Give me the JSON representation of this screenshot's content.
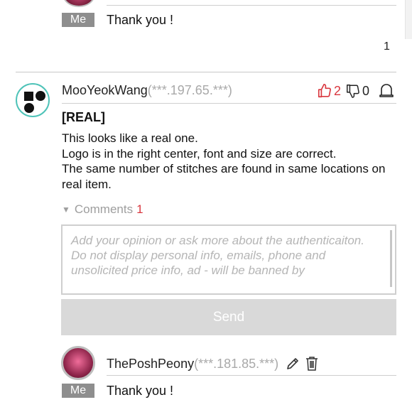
{
  "top_reply": {
    "badge": "Me",
    "text": "Thank you !",
    "page_number": "1"
  },
  "post": {
    "author": "MooYeokWang",
    "ip": "(***.197.65.***)",
    "likes": "2",
    "dislikes": "0",
    "verdict": "[REAL]",
    "lines": [
      "This looks like a real one.",
      "Logo is in the right center, font and size are correct.",
      "The same number of stitches are found in same locations on real item."
    ]
  },
  "comments": {
    "label": "Comments",
    "count": "1"
  },
  "opinion_box": {
    "placeholder": "Add your opinion or ask more about the authenticaiton.\nDo not display personal info, emails, phone and unsolicited price info, ad - will be banned by"
  },
  "send_button": {
    "label": "Send"
  },
  "bottom_reply": {
    "author": "ThePoshPeony",
    "ip": "(***.181.85.***)",
    "badge": "Me",
    "text": "Thank you !"
  },
  "colors": {
    "accent_red": "#d9373f",
    "logo_ring": "#4ec3b8",
    "badge_gray": "#8e8e8e",
    "button_gray": "#d9d9d9"
  },
  "icons": [
    "thumbs-up-icon",
    "thumbs-down-icon",
    "bell-icon",
    "pencil-icon",
    "trash-icon",
    "triangle-down-icon"
  ]
}
